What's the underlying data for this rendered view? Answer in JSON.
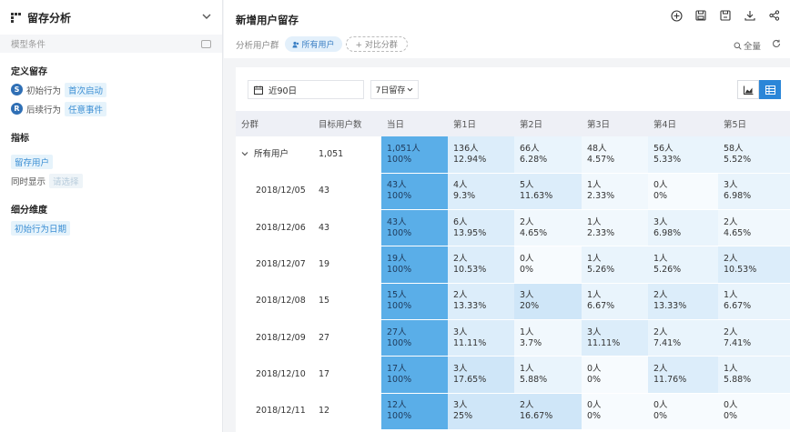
{
  "sidebar": {
    "title": "留存分析",
    "model_label": "模型条件",
    "define_title": "定义留存",
    "initial_badge": "S",
    "initial_label": "初始行为",
    "initial_value": "首次启动",
    "follow_badge": "R",
    "follow_label": "后续行为",
    "follow_value": "任意事件",
    "metric_title": "指标",
    "metric_value": "留存用户",
    "show_label": "同时显示",
    "show_placeholder": "请选择",
    "dimension_title": "细分维度",
    "dimension_value": "初始行为日期"
  },
  "header": {
    "title": "新增用户留存",
    "group_label": "分析用户群",
    "group_value": "所有用户",
    "compare_label": "+ 对比分群",
    "full_label": "全量",
    "icons": [
      "add-circle-icon",
      "save-icon",
      "save-as-icon",
      "download-icon",
      "share-icon"
    ]
  },
  "toolbar": {
    "date_range": "近90日",
    "retention_period": "7日留存"
  },
  "table": {
    "headers": [
      "分群",
      "目标用户数",
      "当日",
      "第1日",
      "第2日",
      "第3日",
      "第4日",
      "第5日"
    ],
    "rows": [
      {
        "label": "所有用户",
        "users": "1,051",
        "cells": [
          [
            "1,051人",
            "100%"
          ],
          [
            "136人",
            "12.94%"
          ],
          [
            "66人",
            "6.28%"
          ],
          [
            "48人",
            "4.57%"
          ],
          [
            "56人",
            "5.33%"
          ],
          [
            "58人",
            "5.52%"
          ]
        ]
      },
      {
        "label": "2018/12/05",
        "users": "43",
        "cells": [
          [
            "43人",
            "100%"
          ],
          [
            "4人",
            "9.3%"
          ],
          [
            "5人",
            "11.63%"
          ],
          [
            "1人",
            "2.33%"
          ],
          [
            "0人",
            "0%"
          ],
          [
            "3人",
            "6.98%"
          ]
        ]
      },
      {
        "label": "2018/12/06",
        "users": "43",
        "cells": [
          [
            "43人",
            "100%"
          ],
          [
            "6人",
            "13.95%"
          ],
          [
            "2人",
            "4.65%"
          ],
          [
            "1人",
            "2.33%"
          ],
          [
            "3人",
            "6.98%"
          ],
          [
            "2人",
            "4.65%"
          ]
        ]
      },
      {
        "label": "2018/12/07",
        "users": "19",
        "cells": [
          [
            "19人",
            "100%"
          ],
          [
            "2人",
            "10.53%"
          ],
          [
            "0人",
            "0%"
          ],
          [
            "1人",
            "5.26%"
          ],
          [
            "1人",
            "5.26%"
          ],
          [
            "2人",
            "10.53%"
          ]
        ]
      },
      {
        "label": "2018/12/08",
        "users": "15",
        "cells": [
          [
            "15人",
            "100%"
          ],
          [
            "2人",
            "13.33%"
          ],
          [
            "3人",
            "20%"
          ],
          [
            "1人",
            "6.67%"
          ],
          [
            "2人",
            "13.33%"
          ],
          [
            "1人",
            "6.67%"
          ]
        ]
      },
      {
        "label": "2018/12/09",
        "users": "27",
        "cells": [
          [
            "27人",
            "100%"
          ],
          [
            "3人",
            "11.11%"
          ],
          [
            "1人",
            "3.7%"
          ],
          [
            "3人",
            "11.11%"
          ],
          [
            "2人",
            "7.41%"
          ],
          [
            "2人",
            "7.41%"
          ]
        ]
      },
      {
        "label": "2018/12/10",
        "users": "17",
        "cells": [
          [
            "17人",
            "100%"
          ],
          [
            "3人",
            "17.65%"
          ],
          [
            "1人",
            "5.88%"
          ],
          [
            "0人",
            "0%"
          ],
          [
            "2人",
            "11.76%"
          ],
          [
            "1人",
            "5.88%"
          ]
        ]
      },
      {
        "label": "2018/12/11",
        "users": "12",
        "cells": [
          [
            "12人",
            "100%"
          ],
          [
            "3人",
            "25%"
          ],
          [
            "2人",
            "16.67%"
          ],
          [
            "0人",
            "0%"
          ],
          [
            "0人",
            "0%"
          ],
          [
            "0人",
            "0%"
          ]
        ]
      }
    ]
  },
  "colors": {
    "accent": "#2b86d8",
    "day0_cell": "#5aaee8",
    "retention_cell_light": "#e8f3fc",
    "retention_cell_mid": "#cfe6f8"
  }
}
